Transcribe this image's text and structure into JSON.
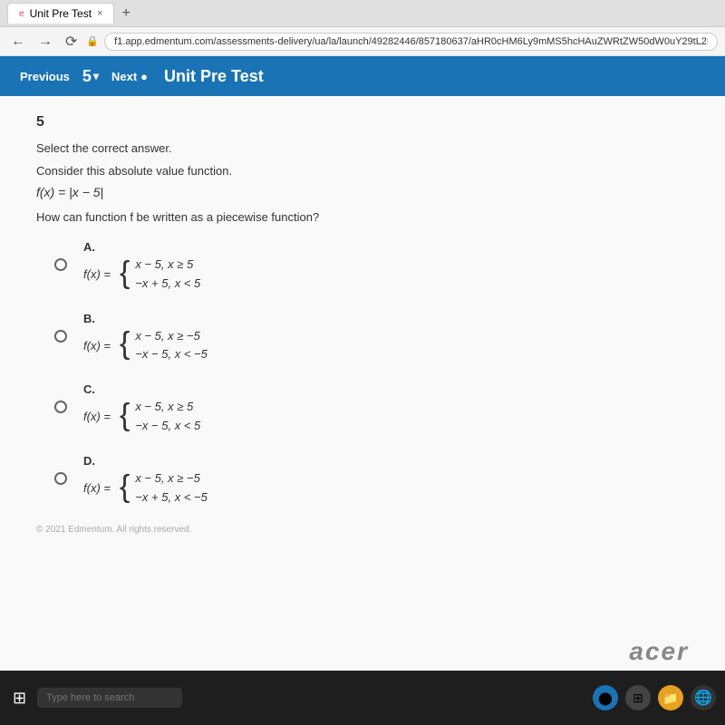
{
  "browser": {
    "tab_label": "Unit Pre Test",
    "tab_favicon": "e",
    "tab_close": "×",
    "tab_new": "+",
    "address": "f1.app.edmentum.com/assessments-delivery/ua/la/launch/49282446/857180637/aHR0cHM6Ly9mMS5hcHAuZWRtZW50dW0uY29tL2Fzc2Vzc21lbnRzL...",
    "back": "←",
    "forward": "→",
    "reload": "⟳"
  },
  "toolbar": {
    "prev_label": "Previous",
    "question_num": "5",
    "chevron": "▾",
    "next_label": "Next",
    "next_icon": "●",
    "title": "Unit Pre Test"
  },
  "content": {
    "question_number": "5",
    "instruction": "Select the correct answer.",
    "question_text": "Consider this absolute value function.",
    "function_display": "f(x) = |x − 5|",
    "how_text": "How can function f be written as a piecewise function?",
    "options": [
      {
        "id": "A",
        "eq": "f(x) =",
        "line1": "x − 5,   x ≥ 5",
        "line2": "−x + 5,  x < 5"
      },
      {
        "id": "B",
        "eq": "f(x) =",
        "line1": "x − 5,   x ≥ −5",
        "line2": "−x − 5,  x < −5"
      },
      {
        "id": "C",
        "eq": "f(x) =",
        "line1": "x − 5,   x ≥ 5",
        "line2": "−x − 5,  x < 5"
      },
      {
        "id": "D",
        "eq": "f(x) =",
        "line1": "x − 5,   x ≥ −5",
        "line2": "−x + 5,  x < −5"
      }
    ]
  },
  "footer": {
    "text": "© 2021 Edmentum. All rights reserved."
  },
  "taskbar": {
    "search_placeholder": "Type here to search",
    "acer_logo": "acer"
  }
}
